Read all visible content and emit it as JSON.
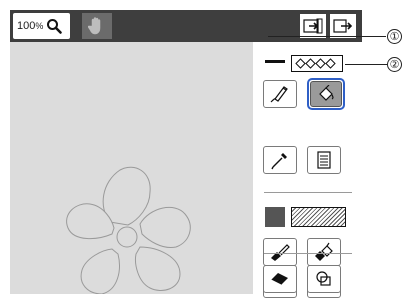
{
  "zoom": {
    "value": "100",
    "unit": "%"
  },
  "callouts": [
    "①",
    "②"
  ],
  "icons": {
    "zoom": "magnifier-icon",
    "pan": "hand-icon",
    "import": "import-icon",
    "export": "export-icon"
  },
  "colors": {
    "toolbar_bg": "#3e3e3e",
    "canvas_bg": "#dcdcdc",
    "selection_highlight": "#2f5fc6",
    "fill_swatch": "#555555"
  }
}
